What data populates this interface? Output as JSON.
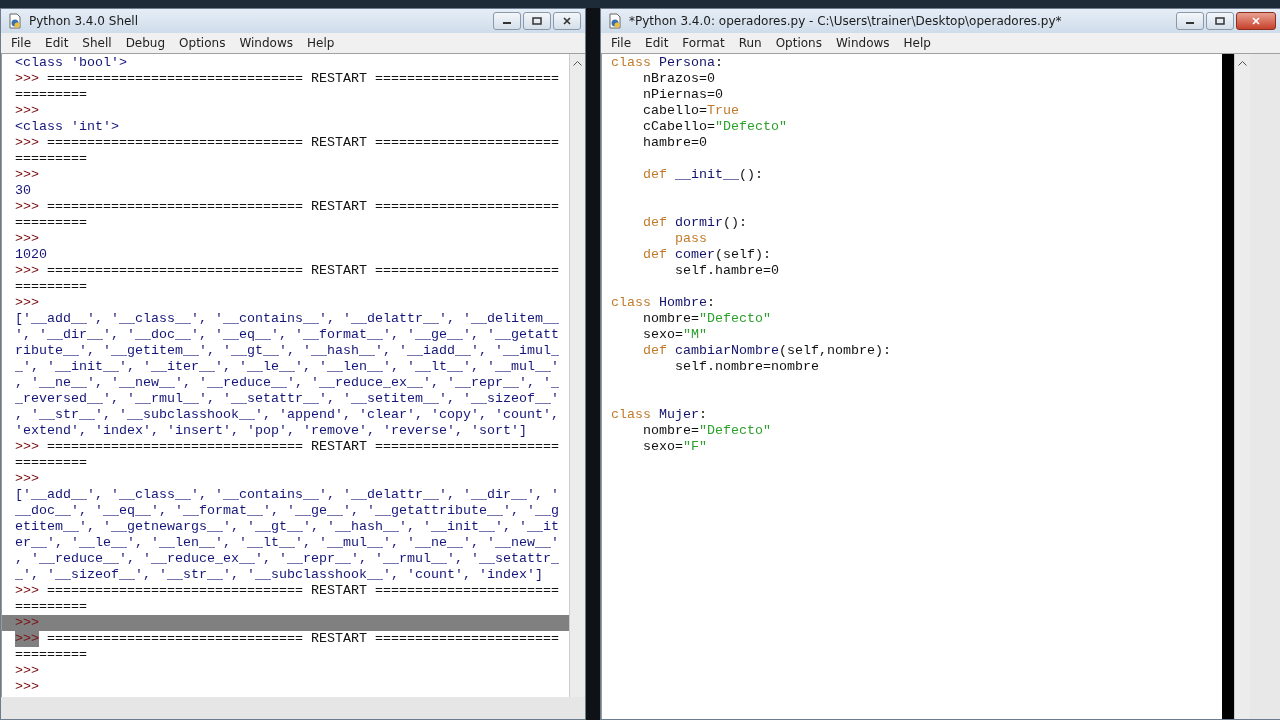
{
  "shell": {
    "title": "Python 3.4.0 Shell",
    "menu": [
      "File",
      "Edit",
      "Shell",
      "Debug",
      "Options",
      "Windows",
      "Help"
    ],
    "lines": [
      {
        "kind": "output",
        "text": "<class 'bool'>",
        "selected": false
      },
      {
        "kind": "restart",
        "prompt": ">>>",
        "text": "================================ RESTART =======================",
        "selected": false
      },
      {
        "kind": "rule",
        "text": "=========",
        "selected": false
      },
      {
        "kind": "prompt",
        "prompt": ">>>",
        "selected": false
      },
      {
        "kind": "output",
        "text": "<class 'int'>",
        "selected": false
      },
      {
        "kind": "restart",
        "prompt": ">>>",
        "text": "================================ RESTART =======================",
        "selected": false
      },
      {
        "kind": "rule",
        "text": "=========",
        "selected": false
      },
      {
        "kind": "prompt",
        "prompt": ">>>",
        "selected": false
      },
      {
        "kind": "output",
        "text": "30",
        "selected": false
      },
      {
        "kind": "restart",
        "prompt": ">>>",
        "text": "================================ RESTART =======================",
        "selected": false
      },
      {
        "kind": "rule",
        "text": "=========",
        "selected": false
      },
      {
        "kind": "prompt",
        "prompt": ">>>",
        "selected": false
      },
      {
        "kind": "output",
        "text": "1020",
        "selected": false
      },
      {
        "kind": "restart",
        "prompt": ">>>",
        "text": "================================ RESTART =======================",
        "selected": false
      },
      {
        "kind": "rule",
        "text": "=========",
        "selected": false
      },
      {
        "kind": "prompt",
        "prompt": ">>>",
        "selected": false
      },
      {
        "kind": "output",
        "text": "['__add__', '__class__', '__contains__', '__delattr__', '__delitem__",
        "selected": false
      },
      {
        "kind": "output",
        "text": "', '__dir__', '__doc__', '__eq__', '__format__', '__ge__', '__getatt",
        "selected": false
      },
      {
        "kind": "output",
        "text": "ribute__', '__getitem__', '__gt__', '__hash__', '__iadd__', '__imul_",
        "selected": false
      },
      {
        "kind": "output",
        "text": "_', '__init__', '__iter__', '__le__', '__len__', '__lt__', '__mul__'",
        "selected": false
      },
      {
        "kind": "output",
        "text": ", '__ne__', '__new__', '__reduce__', '__reduce_ex__', '__repr__', '_",
        "selected": false
      },
      {
        "kind": "output",
        "text": "_reversed__', '__rmul__', '__setattr__', '__setitem__', '__sizeof__'",
        "selected": false
      },
      {
        "kind": "output",
        "text": ", '__str__', '__subclasshook__', 'append', 'clear', 'copy', 'count',",
        "selected": false
      },
      {
        "kind": "output",
        "text": "'extend', 'index', 'insert', 'pop', 'remove', 'reverse', 'sort']",
        "selected": false
      },
      {
        "kind": "restart",
        "prompt": ">>>",
        "text": "================================ RESTART =======================",
        "selected": false
      },
      {
        "kind": "rule",
        "text": "=========",
        "selected": false
      },
      {
        "kind": "prompt",
        "prompt": ">>>",
        "selected": false
      },
      {
        "kind": "output",
        "text": "['__add__', '__class__', '__contains__', '__delattr__', '__dir__', '",
        "selected": false
      },
      {
        "kind": "output",
        "text": "__doc__', '__eq__', '__format__', '__ge__', '__getattribute__', '__g",
        "selected": false
      },
      {
        "kind": "output",
        "text": "etitem__', '__getnewargs__', '__gt__', '__hash__', '__init__', '__it",
        "selected": false
      },
      {
        "kind": "output",
        "text": "er__', '__le__', '__len__', '__lt__', '__mul__', '__ne__', '__new__'",
        "selected": false
      },
      {
        "kind": "output",
        "text": ", '__reduce__', '__reduce_ex__', '__repr__', '__rmul__', '__setattr_",
        "selected": false
      },
      {
        "kind": "output",
        "text": "_', '__sizeof__', '__str__', '__subclasshook__', 'count', 'index']",
        "selected": false
      },
      {
        "kind": "restart",
        "prompt": ">>>",
        "text": "================================ RESTART =======================",
        "selected": false
      },
      {
        "kind": "rule",
        "text": "=========",
        "selected": false
      },
      {
        "kind": "prompt",
        "prompt": ">>>",
        "selected": true
      },
      {
        "kind": "restart",
        "prompt": ">>>",
        "text": "================================ RESTART =======================",
        "selected": true
      },
      {
        "kind": "rule",
        "text": "=========",
        "selected": false
      },
      {
        "kind": "prompt",
        "prompt": ">>>",
        "selected": false
      },
      {
        "kind": "prompt",
        "prompt": ">>>",
        "selected": false
      }
    ]
  },
  "editor": {
    "title": "*Python 3.4.0: operadores.py - C:\\Users\\trainer\\Desktop\\operadores.py*",
    "menu": [
      "File",
      "Edit",
      "Format",
      "Run",
      "Options",
      "Windows",
      "Help"
    ],
    "lines": [
      {
        "kind": "code",
        "tokens": [
          {
            "kind": "keyword",
            "text": "class"
          },
          {
            "kind": "name",
            "text": " Persona"
          },
          {
            "kind": "plain",
            "text": ":"
          }
        ]
      },
      {
        "kind": "code",
        "tokens": [
          {
            "kind": "plain",
            "text": "    nBrazos=0"
          }
        ]
      },
      {
        "kind": "code",
        "tokens": [
          {
            "kind": "plain",
            "text": "    nPiernas=0"
          }
        ]
      },
      {
        "kind": "code",
        "tokens": [
          {
            "kind": "plain",
            "text": "    cabello="
          },
          {
            "kind": "keyword",
            "text": "True"
          }
        ]
      },
      {
        "kind": "code",
        "tokens": [
          {
            "kind": "plain",
            "text": "    cCabello="
          },
          {
            "kind": "string",
            "text": "\"Defecto\""
          }
        ]
      },
      {
        "kind": "code",
        "tokens": [
          {
            "kind": "plain",
            "text": "    hambre=0"
          }
        ]
      },
      {
        "kind": "blank"
      },
      {
        "kind": "code",
        "tokens": [
          {
            "kind": "keyword",
            "text": "    def"
          },
          {
            "kind": "name",
            "text": " __init__"
          },
          {
            "kind": "plain",
            "text": "():"
          }
        ]
      },
      {
        "kind": "blank"
      },
      {
        "kind": "blank"
      },
      {
        "kind": "code",
        "tokens": [
          {
            "kind": "keyword",
            "text": "    def"
          },
          {
            "kind": "name",
            "text": " dormir"
          },
          {
            "kind": "plain",
            "text": "():"
          }
        ]
      },
      {
        "kind": "code",
        "tokens": [
          {
            "kind": "keyword",
            "text": "        pass"
          }
        ]
      },
      {
        "kind": "code",
        "tokens": [
          {
            "kind": "keyword",
            "text": "    def"
          },
          {
            "kind": "name",
            "text": " comer"
          },
          {
            "kind": "plain",
            "text": "(self):"
          }
        ]
      },
      {
        "kind": "code",
        "tokens": [
          {
            "kind": "plain",
            "text": "        self.hambre=0"
          }
        ]
      },
      {
        "kind": "blank"
      },
      {
        "kind": "code",
        "tokens": [
          {
            "kind": "keyword",
            "text": "class"
          },
          {
            "kind": "name",
            "text": " Hombre"
          },
          {
            "kind": "plain",
            "text": ":"
          }
        ]
      },
      {
        "kind": "code",
        "tokens": [
          {
            "kind": "plain",
            "text": "    nombre="
          },
          {
            "kind": "string",
            "text": "\"Defecto\""
          }
        ]
      },
      {
        "kind": "code",
        "tokens": [
          {
            "kind": "plain",
            "text": "    sexo="
          },
          {
            "kind": "string",
            "text": "\"M\""
          }
        ]
      },
      {
        "kind": "code",
        "tokens": [
          {
            "kind": "keyword",
            "text": "    def"
          },
          {
            "kind": "name",
            "text": " cambiarNombre"
          },
          {
            "kind": "plain",
            "text": "(self,nombre):"
          }
        ]
      },
      {
        "kind": "code",
        "tokens": [
          {
            "kind": "plain",
            "text": "        self.nombre=nombre"
          }
        ]
      },
      {
        "kind": "blank"
      },
      {
        "kind": "blank"
      },
      {
        "kind": "code",
        "tokens": [
          {
            "kind": "keyword",
            "text": "class"
          },
          {
            "kind": "name",
            "text": " Mujer"
          },
          {
            "kind": "plain",
            "text": ":"
          }
        ]
      },
      {
        "kind": "code",
        "tokens": [
          {
            "kind": "plain",
            "text": "    nombre="
          },
          {
            "kind": "string",
            "text": "\"Defecto\""
          }
        ]
      },
      {
        "kind": "code",
        "tokens": [
          {
            "kind": "plain",
            "text": "    sexo="
          },
          {
            "kind": "string",
            "text": "\"F\""
          }
        ]
      }
    ]
  }
}
